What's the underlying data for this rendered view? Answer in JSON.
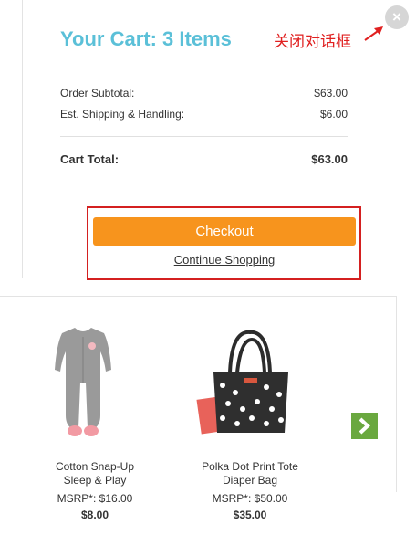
{
  "cart": {
    "title": "Your Cart: 3 Items",
    "annotation": "关闭对话框",
    "close_glyph": "×",
    "rows": [
      {
        "label": "Order Subtotal:",
        "value": "$63.00"
      },
      {
        "label": "Est. Shipping & Handling:",
        "value": "$6.00"
      }
    ],
    "total": {
      "label": "Cart Total:",
      "value": "$63.00"
    },
    "checkout_label": "Checkout",
    "continue_label": "Continue Shopping"
  },
  "recommendations": {
    "products": [
      {
        "name_line1": "Cotton Snap-Up",
        "name_line2": "Sleep & Play",
        "msrp": "MSRP*: $16.00",
        "price": "$8.00"
      },
      {
        "name_line1": "Polka Dot Print Tote",
        "name_line2": "Diaper Bag",
        "msrp": "MSRP*: $50.00",
        "price": "$35.00"
      }
    ]
  },
  "colors": {
    "title": "#5bc0d8",
    "checkout": "#f7941d",
    "highlight_border": "#d42020",
    "next_arrow": "#6aa83f"
  },
  "icons": [
    "close-icon",
    "annotation-arrow-icon",
    "next-arrow-icon"
  ]
}
